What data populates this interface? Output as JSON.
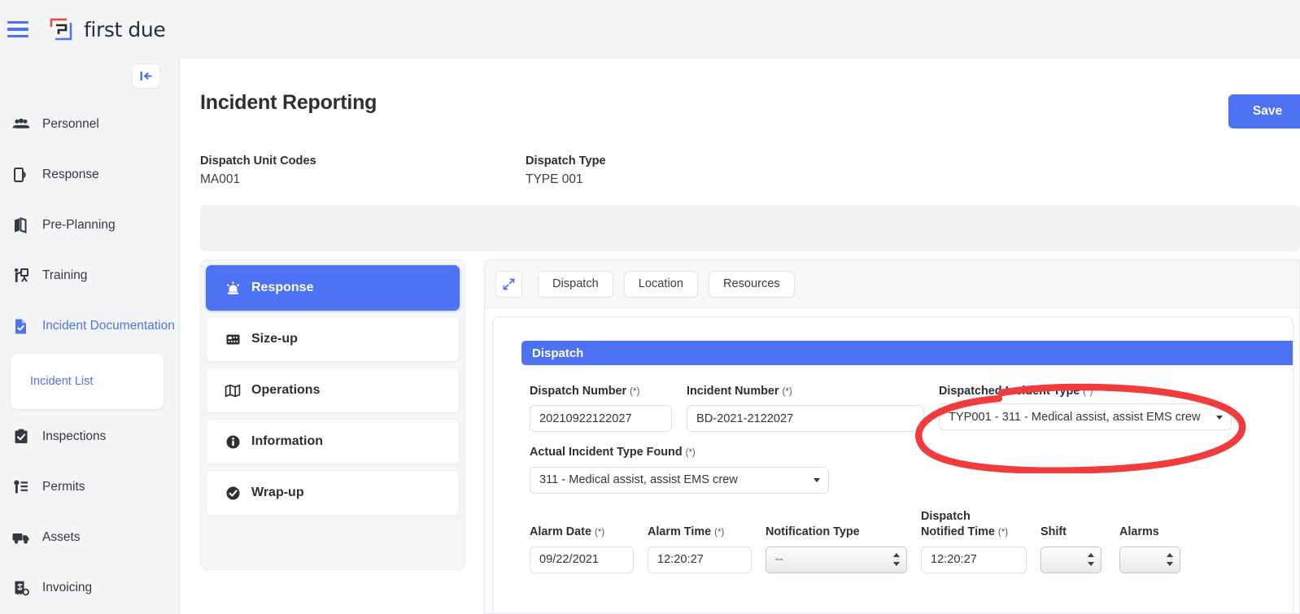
{
  "brand": {
    "name": "first due",
    "logo_icon": "first-due-logo-icon",
    "menu_icon": "hamburger-menu-icon"
  },
  "sidebar": {
    "collapse_icon": "collapse-sidebar-icon",
    "items": [
      {
        "label": "Personnel",
        "icon": "people-icon",
        "active": false
      },
      {
        "label": "Response",
        "icon": "response-device-icon",
        "active": false
      },
      {
        "label": "Pre-Planning",
        "icon": "map-book-icon",
        "active": false
      },
      {
        "label": "Training",
        "icon": "training-presenter-icon",
        "active": false
      },
      {
        "label": "Incident Documentation",
        "icon": "document-check-icon",
        "active": true
      },
      {
        "label": "Inspections",
        "icon": "clipboard-check-icon",
        "active": false
      },
      {
        "label": "Permits",
        "icon": "key-list-icon",
        "active": false
      },
      {
        "label": "Assets",
        "icon": "truck-icon",
        "active": false
      },
      {
        "label": "Invoicing",
        "icon": "invoice-icon",
        "active": false
      }
    ],
    "sub_items": [
      {
        "label": "Incident List"
      }
    ]
  },
  "header": {
    "title": "Incident Reporting",
    "save_label": "Save "
  },
  "meta": [
    {
      "label": "Dispatch Unit Codes",
      "value": "MA001"
    },
    {
      "label": "Dispatch Type",
      "value": "TYPE 001"
    }
  ],
  "steps": [
    {
      "label": "Response",
      "icon": "siren-icon",
      "active": true
    },
    {
      "label": "Size-up",
      "icon": "sizeup-grid-icon",
      "active": false
    },
    {
      "label": "Operations",
      "icon": "map-icon",
      "active": false
    },
    {
      "label": "Information",
      "icon": "info-circle-icon",
      "active": false
    },
    {
      "label": "Wrap-up",
      "icon": "check-circle-icon",
      "active": false
    }
  ],
  "panel": {
    "expand_icon": "expand-diagonal-icon",
    "tabs": [
      {
        "label": "Dispatch"
      },
      {
        "label": "Location"
      },
      {
        "label": "Resources"
      }
    ],
    "section_title": "Dispatch"
  },
  "form": {
    "dispatch_number": {
      "label": "Dispatch Number",
      "required": "(*)",
      "value": "20210922122027"
    },
    "incident_number": {
      "label": "Incident Number",
      "required": "(*)",
      "value": "BD-2021-2122027"
    },
    "dispatched_incident_type": {
      "label": "Dispatched Incident Type",
      "required": "(*)",
      "value": "TYP001 - 311 - Medical assist, assist EMS crew"
    },
    "actual_incident_type_found": {
      "label": "Actual Incident Type Found",
      "required": "(*)",
      "value": "311 - Medical assist, assist EMS crew"
    },
    "alarm_date": {
      "label": "Alarm Date",
      "required": "(*)",
      "value": "09/22/2021"
    },
    "alarm_time": {
      "label": "Alarm Time",
      "required": "(*)",
      "value": "12:20:27"
    },
    "notification_type": {
      "label": "Notification Type",
      "required": "",
      "value": "--"
    },
    "dispatch_notified_time": {
      "label": "Dispatch Notified Time",
      "required": "(*)",
      "value": "12:20:27"
    },
    "shift": {
      "label": "Shift",
      "required": "",
      "value": ""
    },
    "alarms": {
      "label": "Alarms",
      "required": "",
      "value": ""
    }
  },
  "annotation": {
    "shape": "red-ellipse-highlight",
    "target": "dispatched-incident-type-field",
    "color": "#f03c3c"
  },
  "colors": {
    "accent_blue": "#4d72f4",
    "annotation_red": "#f03c3c",
    "chrome_gray": "#f4f5f7",
    "text_dark": "#2b2f36"
  }
}
